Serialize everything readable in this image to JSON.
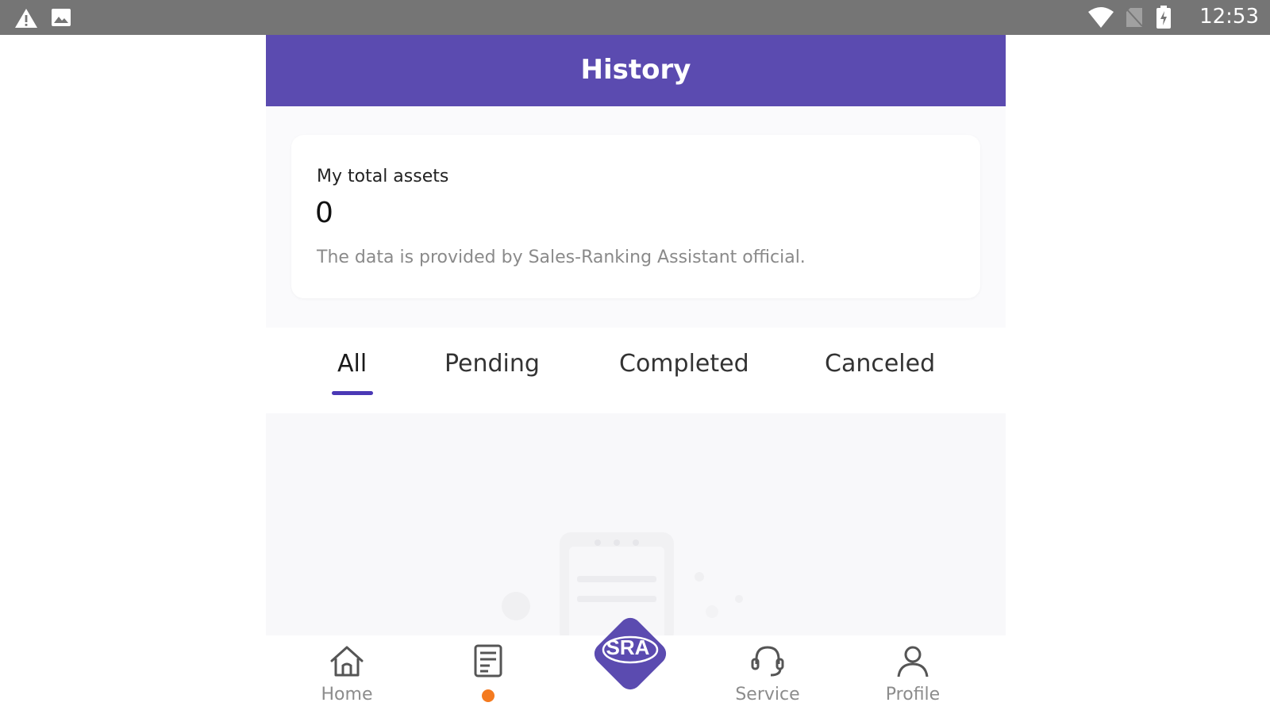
{
  "status_bar": {
    "left_icons": [
      "warning-icon",
      "image-icon"
    ],
    "right_icons": [
      "wifi-icon",
      "no-sim-icon",
      "battery-charging-icon"
    ],
    "time": "12:53"
  },
  "header": {
    "title": "History"
  },
  "assets_card": {
    "label": "My total assets",
    "value": "0",
    "note": "The data is provided by Sales-Ranking Assistant official."
  },
  "tabs": {
    "items": [
      "All",
      "Pending",
      "Completed",
      "Canceled"
    ],
    "active": "All",
    "accent_color": "#4a38b5"
  },
  "bottom_nav": {
    "home_label": "Home",
    "orders_icon": "document-list-icon",
    "center_logo_text": "SRA",
    "service_label": "Service",
    "profile_label": "Profile",
    "notification_dot_color": "#f47a1f",
    "center_color": "#5b4bb0"
  },
  "colors": {
    "header_bg": "#5b4bb0",
    "status_bar_bg": "#757575",
    "page_bg": "#fafafc"
  }
}
